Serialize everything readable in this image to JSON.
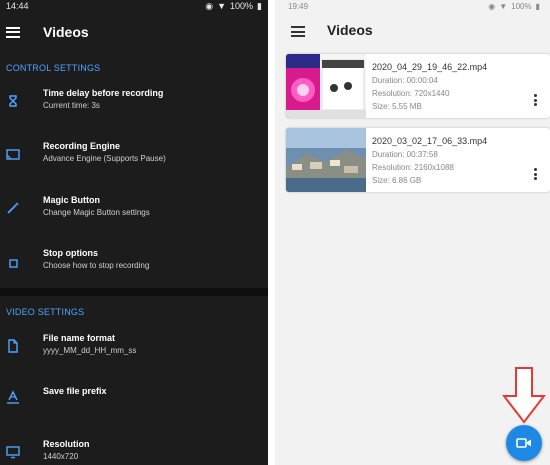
{
  "left": {
    "status": {
      "time": "14:44",
      "battery": "100%"
    },
    "app_title": "Videos",
    "sections": [
      {
        "label": "CONTROL SETTINGS"
      },
      {
        "label": "VIDEO SETTINGS"
      }
    ],
    "items": [
      {
        "title": "Time delay before recording",
        "subtitle": "Current time: 3s",
        "icon": "hourglass-icon"
      },
      {
        "title": "Recording Engine",
        "subtitle": "Advance Engine (Supports Pause)",
        "icon": "cast-icon"
      },
      {
        "title": "Magic Button",
        "subtitle": "Change Magic Button settings",
        "icon": "magic-wand-icon"
      },
      {
        "title": "Stop options",
        "subtitle": "Choose how to stop recording",
        "icon": "stop-icon"
      },
      {
        "title": "File name format",
        "subtitle": "yyyy_MM_dd_HH_mm_ss",
        "icon": "file-icon"
      },
      {
        "title": "Save file prefix",
        "subtitle": "",
        "icon": "text-format-icon"
      },
      {
        "title": "Resolution",
        "subtitle": "1440x720",
        "icon": "monitor-icon"
      }
    ]
  },
  "right": {
    "status": {
      "time": "19:49",
      "battery": "100%"
    },
    "app_title": "Videos",
    "videos": [
      {
        "name": "2020_04_29_19_46_22.mp4",
        "duration": "Duration: 00:00:04",
        "resolution": "Resolution: 720x1440",
        "size": "Size: 5.55 MB"
      },
      {
        "name": "2020_03_02_17_06_33.mp4",
        "duration": "Duration: 00:37:58",
        "resolution": "Resolution: 2160x1088",
        "size": "Size: 6.86 GB"
      }
    ]
  },
  "colors": {
    "accent": "#1e88e5",
    "section": "#4fa3ff",
    "arrow": "#e53935",
    "dark_bg": "#1c1c1c"
  }
}
